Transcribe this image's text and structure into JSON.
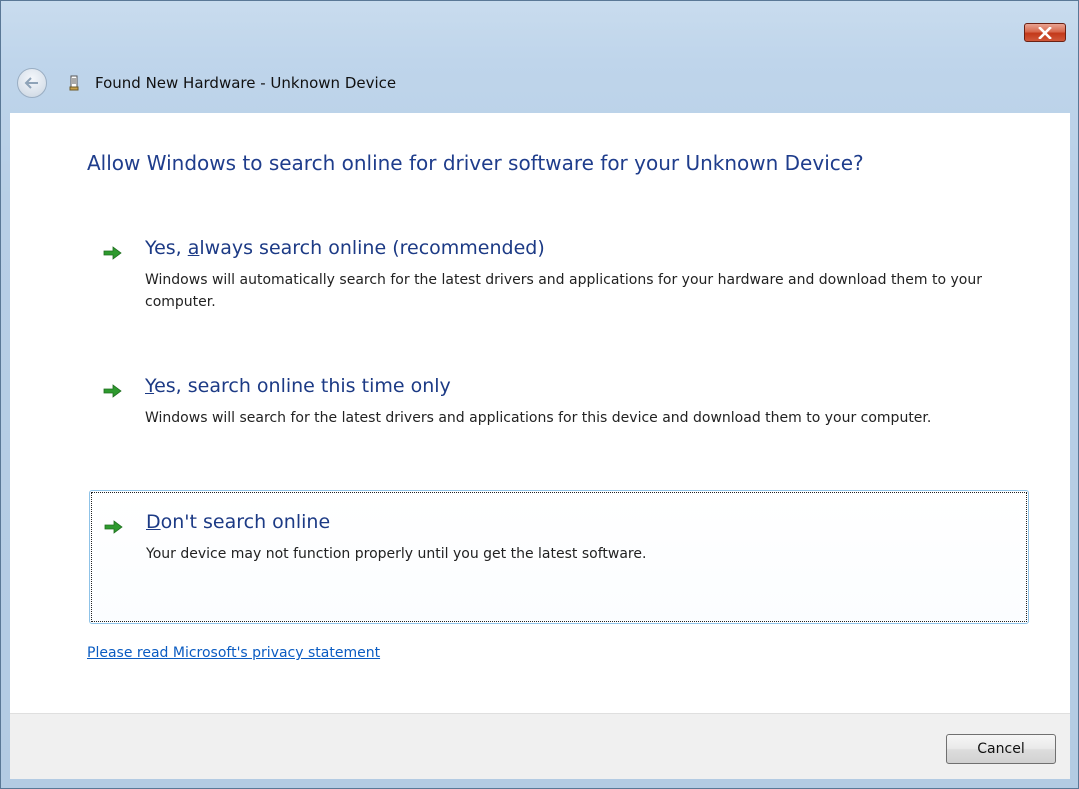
{
  "window": {
    "title": "Found New Hardware - Unknown Device"
  },
  "instruction": "Allow Windows to search online for driver software for your Unknown Device?",
  "options": [
    {
      "title_pre": "Yes, ",
      "title_mnemonic": "a",
      "title_post": "lways search online (recommended)",
      "description": "Windows will automatically search for the latest drivers and applications for your hardware and download them to your computer."
    },
    {
      "title_pre": "",
      "title_mnemonic": "Y",
      "title_post": "es, search online this time only",
      "description": "Windows will search for the latest drivers and applications for this device and download them to your computer."
    },
    {
      "title_pre": "",
      "title_mnemonic": "D",
      "title_post": "on't search online",
      "description": "Your device may not function properly until you get the latest software."
    }
  ],
  "privacy_link": "Please read Microsoft's  privacy statement",
  "footer": {
    "cancel_label": "Cancel"
  },
  "icons": {
    "close": "close-icon",
    "back": "back-arrow-icon",
    "hardware": "hardware-device-icon",
    "option_arrow": "green-arrow-icon"
  },
  "colors": {
    "instruction_text": "#1f3d8c",
    "link": "#0b5cc2",
    "arrow_green": "#2e9a2e",
    "close_button": "#c3391a"
  }
}
